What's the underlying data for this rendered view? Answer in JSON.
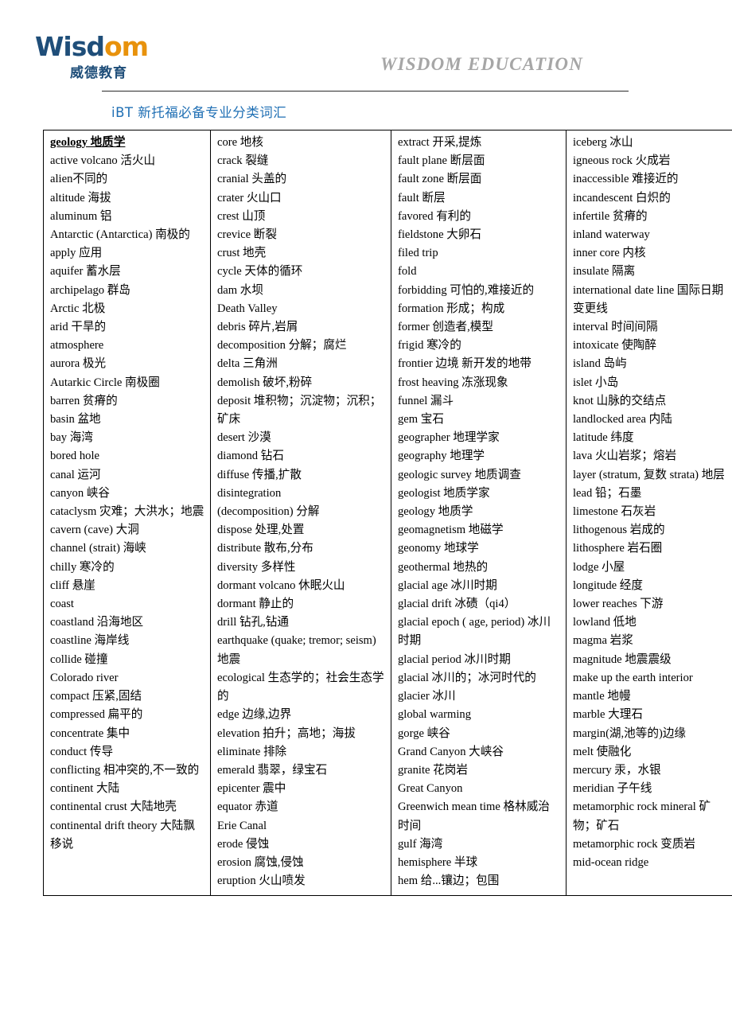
{
  "header": {
    "logo_main": "Wisd",
    "logo_accent": "om",
    "logo_cn": "威德教育",
    "brand_en": "WISDOM EDUCATION",
    "doc_title": "iBT  新托福必备专业分类词汇"
  },
  "table": {
    "columns": [
      {
        "name": "column-1",
        "entries": [
          {
            "text": "geology  地质学",
            "heading": true
          },
          {
            "text": "active volcano  活火山"
          },
          {
            "text": "alien不同的"
          },
          {
            "text": "altitude  海拔"
          },
          {
            "text": "aluminum  铝"
          },
          {
            "text": "Antarctic  (Antarctica)  南极的"
          },
          {
            "text": "apply 应用"
          },
          {
            "text": "aquifer 蓄水层"
          },
          {
            "text": "archipelago  群岛"
          },
          {
            "text": "Arctic  北极"
          },
          {
            "text": "arid 干旱的"
          },
          {
            "text": "atmosphere"
          },
          {
            "text": "aurora  极光"
          },
          {
            "text": "Autarkic Circle  南极圈"
          },
          {
            "text": "barren 贫瘠的"
          },
          {
            "text": "basin  盆地"
          },
          {
            "text": "bay  海湾"
          },
          {
            "text": "bored hole"
          },
          {
            "text": "canal 运河"
          },
          {
            "text": "canyon 峡谷"
          },
          {
            "text": "cataclysm  灾难；大洪水；地震"
          },
          {
            "text": "cavern (cave)  大洞"
          },
          {
            "text": "channel (strait)  海峡"
          },
          {
            "text": "chilly 寒冷的"
          },
          {
            "text": "cliff 悬崖"
          },
          {
            "text": "coast"
          },
          {
            "text": "coastland  沿海地区"
          },
          {
            "text": "coastline 海岸线"
          },
          {
            "text": "collide 碰撞"
          },
          {
            "text": "Colorado river"
          },
          {
            "text": "compact 压紧,固结"
          },
          {
            "text": "compressed 扁平的"
          },
          {
            "text": "concentrate 集中"
          },
          {
            "text": "conduct 传导"
          },
          {
            "text": "conflicting 相冲突的,不一致的"
          },
          {
            "text": "continent  大陆"
          },
          {
            "text": "continental crust  大陆地壳"
          },
          {
            "text": "continental drift theory 大陆飘移说"
          }
        ]
      },
      {
        "name": "column-2",
        "entries": [
          {
            "text": "core 地核"
          },
          {
            "text": "crack 裂缝"
          },
          {
            "text": "cranial  头盖的"
          },
          {
            "text": "crater 火山口"
          },
          {
            "text": "crest 山顶"
          },
          {
            "text": "crevice 断裂"
          },
          {
            "text": "crust 地壳"
          },
          {
            "text": "cycle 天体的循环"
          },
          {
            "text": "dam 水坝"
          },
          {
            "text": "Death Valley"
          },
          {
            "text": "debris 碎片,岩屑"
          },
          {
            "text": "decomposition  分解；腐烂"
          },
          {
            "text": "delta 三角洲"
          },
          {
            "text": "demolish 破坏,粉碎"
          },
          {
            "text": "deposit  堆积物；沉淀物；沉积；矿床"
          },
          {
            "text": "desert 沙漠"
          },
          {
            "text": "diamond  钻石"
          },
          {
            "text": "diffuse 传播,扩散"
          },
          {
            "text": "disintegration"
          },
          {
            "text": "(decomposition)  分解"
          },
          {
            "text": "dispose 处理,处置"
          },
          {
            "text": "distribute 散布,分布"
          },
          {
            "text": "diversity 多样性"
          },
          {
            "text": "dormant volcano  休眠火山"
          },
          {
            "text": "dormant 静止的"
          },
          {
            "text": "drill 钻孔,钻通"
          },
          {
            "text": "earthquake  (quake;  tremor;  seism) 地震"
          },
          {
            "text": "ecological  生态学的；社会生态学的"
          },
          {
            "text": "edge 边缘,边界"
          },
          {
            "text": "elevation 拍升；高地；海拔"
          },
          {
            "text": "eliminate 排除"
          },
          {
            "text": "emerald  翡翠，绿宝石"
          },
          {
            "text": "epicenter  震中"
          },
          {
            "text": "equator  赤道"
          },
          {
            "text": "Erie Canal"
          },
          {
            "text": "erode 侵蚀"
          },
          {
            "text": "erosion 腐蚀,侵蚀"
          },
          {
            "text": "eruption 火山喷发"
          }
        ]
      },
      {
        "name": "column-3",
        "entries": [
          {
            "text": "extract 开采,提炼"
          },
          {
            "text": "fault plane  断层面"
          },
          {
            "text": "fault zone 断层面"
          },
          {
            "text": "fault 断层"
          },
          {
            "text": "favored 有利的"
          },
          {
            "text": "fieldstone  大卵石"
          },
          {
            "text": "filed trip"
          },
          {
            "text": "fold"
          },
          {
            "text": "forbidding 可怕的,难接近的"
          },
          {
            "text": "formation  形成；构成"
          },
          {
            "text": "former 创造者,模型"
          },
          {
            "text": "frigid  寒冷的"
          },
          {
            "text": "frontier 边境 新开发的地带"
          },
          {
            "text": "frost heaving 冻涨现象"
          },
          {
            "text": "funnel 漏斗"
          },
          {
            "text": "gem  宝石"
          },
          {
            "text": "geographer  地理学家"
          },
          {
            "text": "geography  地理学"
          },
          {
            "text": "geologic survey 地质调查"
          },
          {
            "text": "geologist  地质学家"
          },
          {
            "text": "geology 地质学"
          },
          {
            "text": "geomagnetism 地磁学"
          },
          {
            "text": "geonomy 地球学"
          },
          {
            "text": "geothermal 地热的"
          },
          {
            "text": "glacial age 冰川时期"
          },
          {
            "text": "glacial drift  冰碛（qi4）"
          },
          {
            "text": "glacial  epoch  ( age, period) 冰川时期"
          },
          {
            "text": "glacial period 冰川时期"
          },
          {
            "text": "glacial  冰川的；冰河时代的"
          },
          {
            "text": "glacier  冰川"
          },
          {
            "text": "global warming"
          },
          {
            "text": "gorge 峡谷"
          },
          {
            "text": "Grand Canyon 大峡谷"
          },
          {
            "text": "granite  花岗岩"
          },
          {
            "text": "Great Canyon"
          },
          {
            "text": "Greenwich mean time  格林威治时间"
          },
          {
            "text": "gulf 海湾"
          },
          {
            "text": "hemisphere 半球"
          },
          {
            "text": "hem 给...镶边；包围"
          }
        ]
      },
      {
        "name": "column-4",
        "entries": [
          {
            "text": "iceberg 冰山"
          },
          {
            "text": "igneous rock  火成岩"
          },
          {
            "text": "inaccessible 难接近的"
          },
          {
            "text": "incandescent 白炽的"
          },
          {
            "text": "infertile 贫瘠的"
          },
          {
            "text": "inland waterway"
          },
          {
            "text": "inner core 内核"
          },
          {
            "text": "insulate 隔离"
          },
          {
            "text": "international date line 国际日期变更线"
          },
          {
            "text": "interval 时间间隔"
          },
          {
            "text": "intoxicate 使陶醉"
          },
          {
            "text": "island  岛屿"
          },
          {
            "text": "islet  小岛"
          },
          {
            "text": "knot 山脉的交结点"
          },
          {
            "text": "landlocked area 内陆"
          },
          {
            "text": "latitude  纬度"
          },
          {
            "text": "lava  火山岩浆；熔岩"
          },
          {
            "text": "layer (stratum, 复数  strata) 地层"
          },
          {
            "text": "lead  铅；石墨"
          },
          {
            "text": "limestone  石灰岩"
          },
          {
            "text": "lithogenous  岩成的"
          },
          {
            "text": "lithosphere  岩石圈"
          },
          {
            "text": "lodge 小屋"
          },
          {
            "text": "longitude 经度"
          },
          {
            "text": "lower reaches 下游"
          },
          {
            "text": "lowland  低地"
          },
          {
            "text": "magma  岩浆"
          },
          {
            "text": "magnitude  地震震级"
          },
          {
            "text": "make up the earth interior"
          },
          {
            "text": "mantle  地幔"
          },
          {
            "text": "marble  大理石"
          },
          {
            "text": "margin(湖,池等的)边缘"
          },
          {
            "text": "melt 使融化"
          },
          {
            "text": "mercury  汞，水银"
          },
          {
            "text": "meridian  子午线"
          },
          {
            "text": "metamorphic rock  mineral 矿物；矿石"
          },
          {
            "text": "metamorphic rock  变质岩"
          },
          {
            "text": "mid-ocean ridge"
          }
        ]
      }
    ]
  },
  "colors": {
    "logo_blue": "#1f4e79",
    "logo_orange": "#e8920c",
    "title_blue": "#1f6fb4",
    "brand_gray": "#a6a6a6"
  }
}
